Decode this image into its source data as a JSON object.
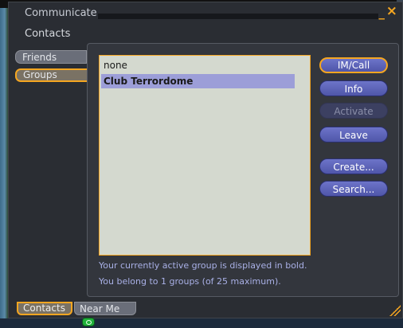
{
  "window": {
    "title": "Communicate",
    "subtitle": "Contacts",
    "minimize_glyph": "_",
    "close_glyph": "×"
  },
  "side_tabs": [
    {
      "label": "Friends",
      "selected": false
    },
    {
      "label": "Groups",
      "selected": true
    }
  ],
  "groups_list": {
    "items": [
      {
        "label": "none",
        "active": false
      },
      {
        "label": "Club Terrordome",
        "active": true
      }
    ]
  },
  "buttons": {
    "im_call": "IM/Call",
    "info": "Info",
    "activate": "Activate",
    "leave": "Leave",
    "create": "Create...",
    "search": "Search..."
  },
  "notes": {
    "active_group": "Your currently active group is displayed in bold.",
    "membership": "You belong to 1 groups (of 25 maximum)."
  },
  "bottom_tabs": [
    {
      "label": "Contacts",
      "selected": true
    },
    {
      "label": "Near Me",
      "selected": false
    }
  ],
  "icons": {
    "voice": "voice-active-icon",
    "resize": "resize-grip-icon"
  },
  "colors": {
    "accent": "#f5a621",
    "button": "#5a61b8",
    "list_bg": "#d4d9cf",
    "selection": "#9c9ed8"
  }
}
